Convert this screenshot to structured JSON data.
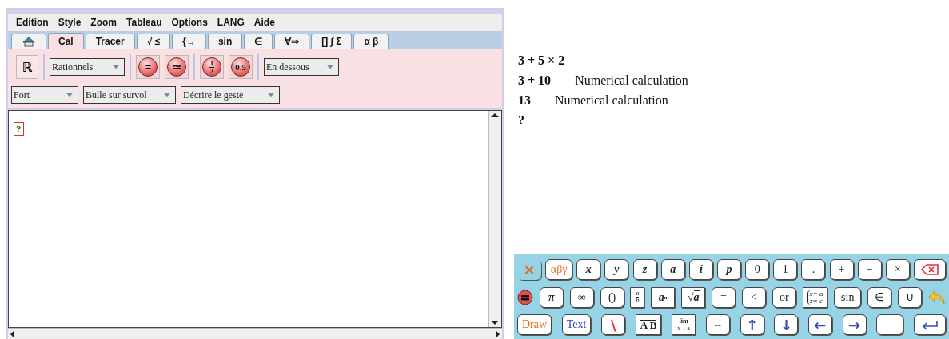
{
  "menu": [
    "Edition",
    "Style",
    "Zoom",
    "Tableau",
    "Options",
    "LANG",
    "Aide"
  ],
  "tabs": [
    {
      "kind": "home",
      "selected": false
    },
    {
      "kind": "text",
      "label": "Cal",
      "selected": true
    },
    {
      "kind": "text",
      "label": "Tracer",
      "selected": false
    },
    {
      "kind": "text",
      "label": "√ ≤",
      "selected": false
    },
    {
      "kind": "text",
      "label": "{→",
      "selected": false
    },
    {
      "kind": "text",
      "label": "sin",
      "selected": false
    },
    {
      "kind": "text",
      "label": "∈",
      "selected": false
    },
    {
      "kind": "text",
      "label": "∀⇒",
      "selected": false
    },
    {
      "kind": "text",
      "label": "[] ∫ Σ",
      "selected": false
    },
    {
      "kind": "text",
      "label": "α β",
      "selected": false
    }
  ],
  "toolbar": [
    [
      [
        {
          "kind": "square",
          "label": "ℝ"
        }
      ],
      [
        {
          "kind": "dropdown",
          "value": "Rationnels"
        }
      ],
      [
        {
          "kind": "round",
          "label": "="
        },
        {
          "kind": "round",
          "label": "≃"
        }
      ],
      [
        {
          "kind": "fraction",
          "num": "1",
          "den": "2"
        },
        {
          "kind": "round",
          "label": "0.5"
        }
      ],
      [
        {
          "kind": "dropdown",
          "value": "En dessous"
        }
      ]
    ],
    [
      [
        {
          "kind": "dropdown",
          "value": "Fort"
        },
        {
          "kind": "dropdown",
          "value": "Bulle sur survol"
        },
        {
          "kind": "dropdown",
          "value": "Décrire le geste"
        }
      ]
    ]
  ],
  "editor": {
    "placeholder": "?"
  },
  "output": [
    {
      "expr": "3 + 5 × 2"
    },
    {
      "expr": "3 + 10",
      "note": "Numerical calculation"
    },
    {
      "expr": "13",
      "note": "Numerical calculation"
    },
    {
      "expr": "?"
    }
  ],
  "keyboard": [
    [
      {
        "kind": "plain",
        "label": "×",
        "color": "#e07020"
      },
      {
        "kind": "key",
        "label": "αβγ",
        "color": "#e07020"
      },
      {
        "kind": "var",
        "label": "x"
      },
      {
        "kind": "var",
        "label": "y"
      },
      {
        "kind": "var",
        "label": "z"
      },
      {
        "kind": "var",
        "label": "a"
      },
      {
        "kind": "var",
        "label": "i"
      },
      {
        "kind": "var",
        "label": "p"
      },
      {
        "kind": "key",
        "label": "0"
      },
      {
        "kind": "key",
        "label": "1"
      },
      {
        "kind": "key",
        "label": "."
      },
      {
        "kind": "key",
        "label": "+"
      },
      {
        "kind": "key",
        "label": "−"
      },
      {
        "kind": "key",
        "label": "×"
      },
      {
        "kind": "backspace"
      }
    ],
    [
      {
        "kind": "equals"
      },
      {
        "kind": "var",
        "label": "π"
      },
      {
        "kind": "key",
        "label": "∞"
      },
      {
        "kind": "key",
        "label": "()"
      },
      {
        "kind": "fraction",
        "num": "a",
        "den": "b"
      },
      {
        "kind": "power",
        "base": "a",
        "exp": "n"
      },
      {
        "kind": "sqrt",
        "sign": "√",
        "label": "a"
      },
      {
        "kind": "key",
        "label": "="
      },
      {
        "kind": "key",
        "label": "<"
      },
      {
        "kind": "key",
        "label": "or"
      },
      {
        "kind": "system",
        "lines": [
          "x= a",
          "z= c"
        ]
      },
      {
        "kind": "key",
        "label": "sin"
      },
      {
        "kind": "key",
        "label": "∈"
      },
      {
        "kind": "key",
        "label": "∪"
      },
      {
        "kind": "undo"
      }
    ],
    [
      {
        "kind": "key",
        "label": "Draw",
        "color": "#e07020"
      },
      {
        "kind": "key",
        "label": "Text",
        "color": "#3a48b0"
      },
      {
        "kind": "key",
        "label": "\\",
        "color": "#e03030"
      },
      {
        "kind": "vector",
        "label": "A B"
      },
      {
        "kind": "limit",
        "label": "lim",
        "sub": "x→a"
      },
      {
        "kind": "key",
        "label": "⇔"
      },
      {
        "kind": "key",
        "label": "↑",
        "color": "#3a48b0"
      },
      {
        "kind": "key",
        "label": "↓",
        "color": "#3a48b0"
      },
      {
        "kind": "key",
        "label": "←",
        "color": "#3a48b0"
      },
      {
        "kind": "key",
        "label": "→",
        "color": "#3a48b0"
      },
      {
        "kind": "blank"
      },
      {
        "kind": "enter"
      }
    ]
  ]
}
